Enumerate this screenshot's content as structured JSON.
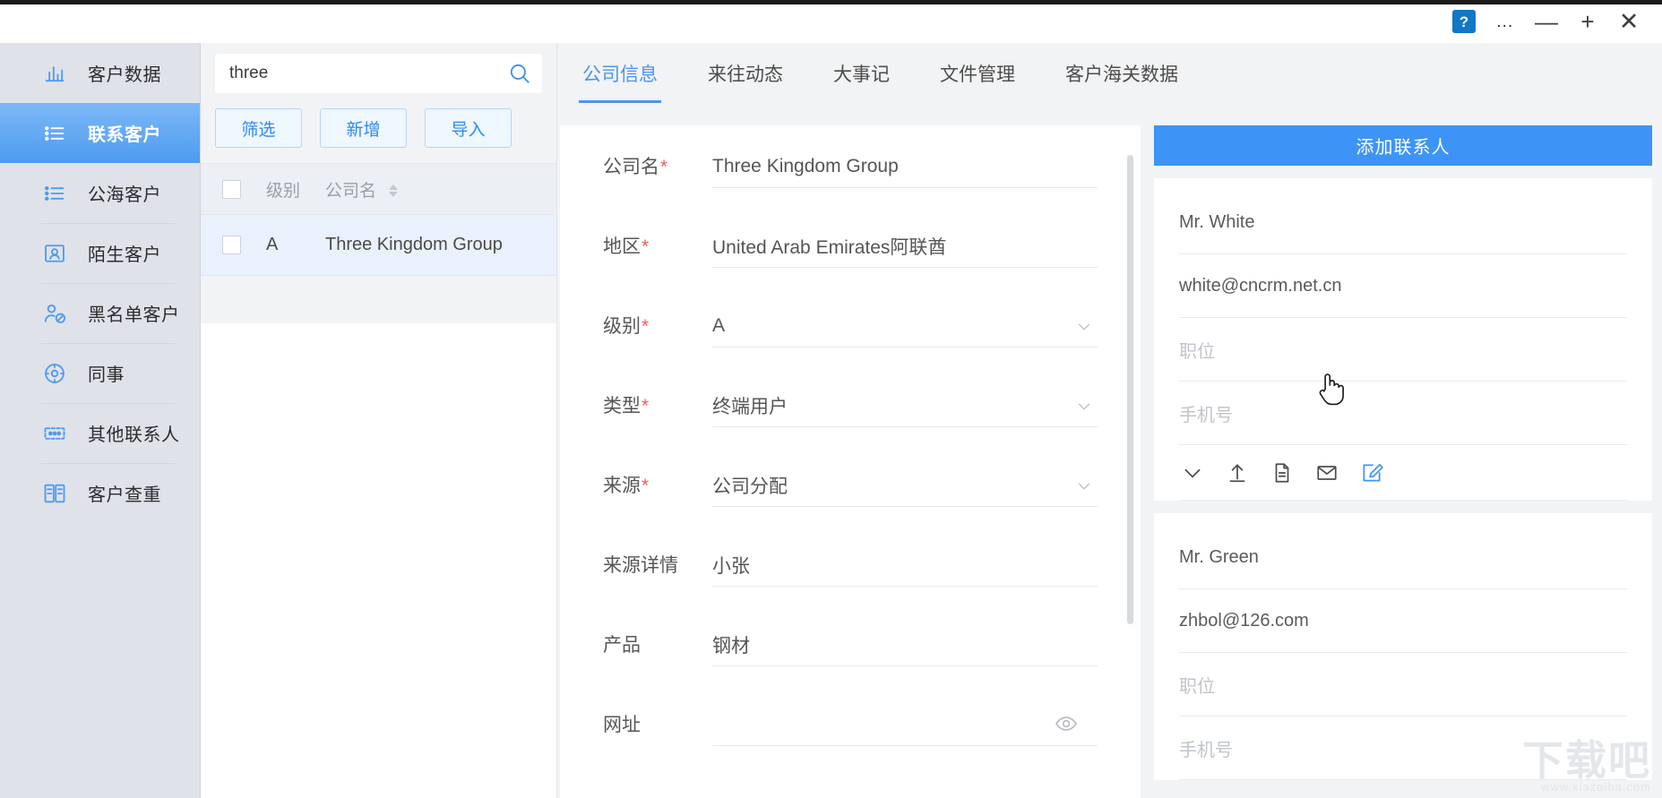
{
  "titlebar": {
    "help_label": "?",
    "more_label": "●●●",
    "minimize_label": "—",
    "maximize_label": "+",
    "close_label": "✕"
  },
  "sidebar": {
    "items": [
      {
        "label": "客户数据",
        "icon": "bar-chart-icon",
        "active": false
      },
      {
        "label": "联系客户",
        "icon": "list-icon",
        "active": true
      },
      {
        "label": "公海客户",
        "icon": "list-icon",
        "active": false
      },
      {
        "label": "陌生客户",
        "icon": "contact-card-icon",
        "active": false
      },
      {
        "label": "黑名单客户",
        "icon": "user-block-icon",
        "active": false
      },
      {
        "label": "同事",
        "icon": "gear-circle-icon",
        "active": false
      },
      {
        "label": "其他联系人",
        "icon": "dots-box-icon",
        "active": false
      },
      {
        "label": "客户查重",
        "icon": "compare-icon",
        "active": false
      }
    ]
  },
  "list_panel": {
    "search": {
      "value": "three",
      "placeholder": ""
    },
    "buttons": [
      {
        "label": "筛选"
      },
      {
        "label": "新增"
      },
      {
        "label": "导入"
      }
    ],
    "columns": {
      "level": "级别",
      "company": "公司名"
    },
    "rows": [
      {
        "level": "A",
        "company": "Three Kingdom Group"
      }
    ]
  },
  "tabs": [
    {
      "label": "公司信息",
      "active": true
    },
    {
      "label": "来往动态",
      "active": false
    },
    {
      "label": "大事记",
      "active": false
    },
    {
      "label": "文件管理",
      "active": false
    },
    {
      "label": "客户海关数据",
      "active": false
    }
  ],
  "form": {
    "fields": [
      {
        "label": "公司名",
        "required": true,
        "value": "Three Kingdom Group",
        "placeholder": "",
        "control": "text"
      },
      {
        "label": "地区",
        "required": true,
        "value": "United Arab Emirates阿联酋",
        "placeholder": "",
        "control": "text"
      },
      {
        "label": "级别",
        "required": true,
        "value": "A",
        "placeholder": "",
        "control": "select"
      },
      {
        "label": "类型",
        "required": true,
        "value": "终端用户",
        "placeholder": "",
        "control": "select"
      },
      {
        "label": "来源",
        "required": true,
        "value": "公司分配",
        "placeholder": "",
        "control": "select"
      },
      {
        "label": "来源详情",
        "required": false,
        "value": "小张",
        "placeholder": "",
        "control": "text"
      },
      {
        "label": "产品",
        "required": false,
        "value": "钢材",
        "placeholder": "",
        "control": "text"
      },
      {
        "label": "网址",
        "required": false,
        "value": "",
        "placeholder": "",
        "control": "eye"
      }
    ]
  },
  "contacts": {
    "add_button": "添加联系人",
    "icon_row": [
      {
        "name": "chevron-down-icon"
      },
      {
        "name": "upload-icon"
      },
      {
        "name": "document-icon"
      },
      {
        "name": "mail-icon"
      },
      {
        "name": "edit-icon"
      }
    ],
    "cards": [
      {
        "name": "Mr. White",
        "email": "white@cncrm.net.cn",
        "position_placeholder": "职位",
        "phone_placeholder": "手机号"
      },
      {
        "name": "Mr. Green",
        "email": "zhbol@126.com",
        "position_placeholder": "职位",
        "phone_placeholder": "手机号"
      }
    ]
  },
  "watermark": {
    "text": "下载吧",
    "sub": "www.xiazaiba.com"
  },
  "colors": {
    "accent": "#3d94f6",
    "nav_active_top": "#7cb8f7",
    "nav_active_bottom": "#4e9bf0",
    "required_red": "#f05b5b"
  }
}
